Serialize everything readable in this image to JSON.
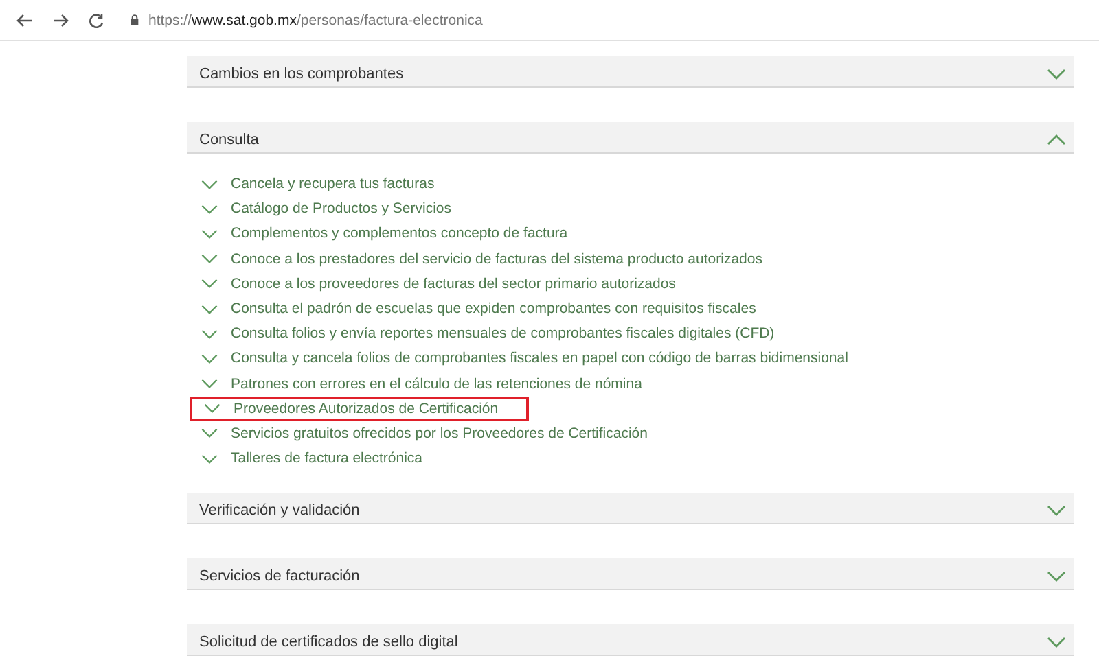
{
  "browser": {
    "url_scheme": "https://",
    "url_host": "www.sat.gob.mx",
    "url_path": "/personas/factura-electronica"
  },
  "sections": [
    {
      "title": "Cambios en los comprobantes",
      "expanded": false
    },
    {
      "title": "Consulta",
      "expanded": true,
      "items": [
        {
          "label": "Cancela y recupera tus facturas",
          "highlighted": false
        },
        {
          "label": "Catálogo de Productos y Servicios",
          "highlighted": false
        },
        {
          "label": "Complementos y complementos concepto de factura",
          "highlighted": false
        },
        {
          "label": "Conoce a los prestadores del servicio de facturas del sistema producto autorizados",
          "highlighted": false
        },
        {
          "label": "Conoce a los proveedores de facturas del sector primario autorizados",
          "highlighted": false
        },
        {
          "label": "Consulta el padrón de escuelas que expiden comprobantes con requisitos fiscales",
          "highlighted": false
        },
        {
          "label": "Consulta folios y envía reportes mensuales de comprobantes fiscales digitales (CFD)",
          "highlighted": false
        },
        {
          "label": "Consulta y cancela folios de comprobantes fiscales en papel con código de barras bidimensional",
          "highlighted": false
        },
        {
          "label": "Patrones con errores en el cálculo de las retenciones de nómina",
          "highlighted": false
        },
        {
          "label": "Proveedores Autorizados de Certificación",
          "highlighted": true
        },
        {
          "label": "Servicios gratuitos ofrecidos por los Proveedores de Certificación",
          "highlighted": false
        },
        {
          "label": "Talleres de factura electrónica",
          "highlighted": false
        }
      ]
    },
    {
      "title": "Verificación y validación",
      "expanded": false
    },
    {
      "title": "Servicios de facturación",
      "expanded": false
    },
    {
      "title": "Solicitud de certificados de sello digital",
      "expanded": false
    }
  ]
}
